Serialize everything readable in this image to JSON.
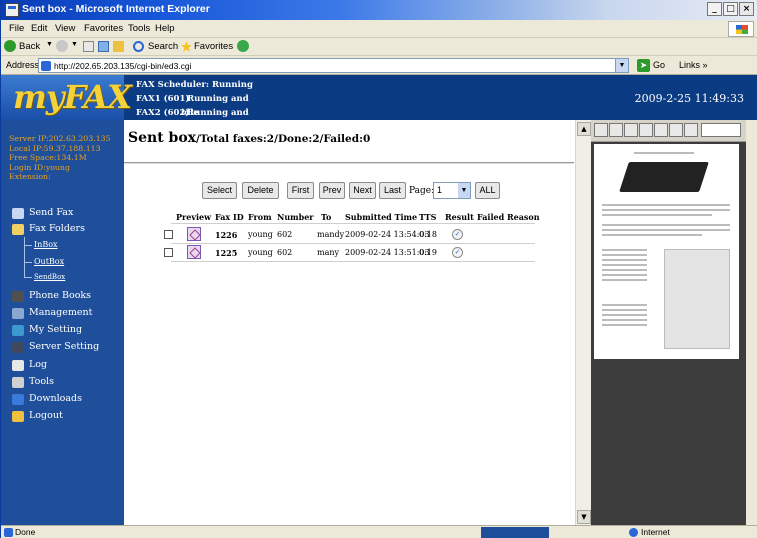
{
  "window": {
    "title": "Sent box - Microsoft Internet Explorer"
  },
  "menu": [
    "File",
    "Edit",
    "View",
    "Favorites",
    "Tools",
    "Help"
  ],
  "toolbar": {
    "back": "Back",
    "search": "Search",
    "favorites": "Favorites"
  },
  "address": {
    "label": "Address",
    "url": "http://202.65.203.135/cgi-bin/ed3.cgi",
    "go": "Go",
    "links": "Links"
  },
  "header": {
    "logo": "myFAX",
    "scheduler": {
      "label": "FAX Scheduler:",
      "value": "Running"
    },
    "lines": [
      {
        "label": "FAX1 (601)",
        "value": ": Running and idle"
      },
      {
        "label": "FAX2 (602)",
        "value": ": Running and idle"
      }
    ],
    "datetime": "2009-2-25 11:49:33"
  },
  "sidebar": {
    "info": [
      "Server IP:202.63.203.135",
      "Local IP:59.37.188.113",
      "Free Space:134.1M",
      "Login ID:young",
      "Extension:"
    ],
    "nav": {
      "send_fax": "Send Fax",
      "fax_folders": "Fax Folders",
      "inbox": "InBox",
      "outbox": "OutBox",
      "sendbox": "SendBox",
      "phone_books": "Phone Books",
      "management": "Management",
      "my_setting": "My Setting",
      "server_setting": "Server Setting",
      "log": "Log",
      "tools": "Tools",
      "downloads": "Downloads",
      "logout": "Logout"
    }
  },
  "main": {
    "title": "Sent box",
    "subtitle": "/Total faxes:2/Done:2/Failed:0",
    "buttons": {
      "select": "Select",
      "delete": "Delete",
      "first": "First",
      "prev": "Prev",
      "next": "Next",
      "last": "Last",
      "all": "ALL"
    },
    "page_label": "Page:",
    "page_value": "1",
    "columns": [
      "Preview",
      "Fax ID",
      "From",
      "Number",
      "To",
      "Submitted Time",
      "TTS",
      "Result",
      "Failed Reason"
    ],
    "rows": [
      {
        "fax_id": "1226",
        "from": "young",
        "number": "602",
        "to": "mandy",
        "submitted": "2009-02-24 13:54:03",
        "tts": "0:18"
      },
      {
        "fax_id": "1225",
        "from": "young",
        "number": "602",
        "to": "many",
        "submitted": "2009-02-24 13:51:03",
        "tts": "0:19"
      }
    ]
  },
  "status": {
    "left": "Done",
    "zone": "Internet"
  }
}
